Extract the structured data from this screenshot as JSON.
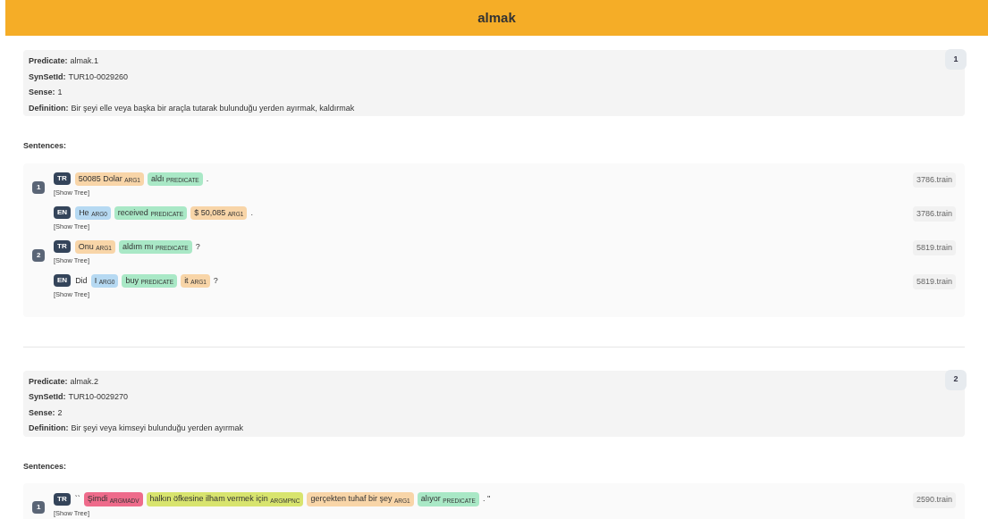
{
  "header": {
    "title": "almak"
  },
  "senses": [
    {
      "number": "1",
      "fields": [
        {
          "label": "Predicate:",
          "value": "almak.1"
        },
        {
          "label": "SynSetId:",
          "value": "TUR10-0029260"
        },
        {
          "label": "Sense:",
          "value": "1"
        },
        {
          "label": "Definition:",
          "value": "Bir şeyi elle veya başka bir araçla tutarak bulunduğu yerden ayırmak, kaldırmak"
        }
      ],
      "sentences_label": "Sentences:",
      "sentences": [
        {
          "index": "1",
          "lang": "TR",
          "tree_link": "[Show Tree]",
          "source": "3786.train",
          "tokens": [
            {
              "kind": "arg",
              "text": "50085 Dolar",
              "role": "ARG1",
              "color": "#f8d5a8"
            },
            {
              "kind": "arg",
              "text": "aldı",
              "role": "PREDICATE",
              "color": "#a9e8c6"
            },
            {
              "kind": "plain",
              "text": "."
            }
          ]
        },
        {
          "lang": "EN",
          "tree_link": "[Show Tree]",
          "source": "3786.train",
          "tokens": [
            {
              "kind": "arg",
              "text": "He",
              "role": "ARG0",
              "color": "#b6d9f2"
            },
            {
              "kind": "arg",
              "text": "received",
              "role": "PREDICATE",
              "color": "#a9e8c6"
            },
            {
              "kind": "arg",
              "text": "$ 50,085",
              "role": "ARG1",
              "color": "#f8d5a8"
            },
            {
              "kind": "plain",
              "text": "."
            }
          ]
        },
        {
          "index": "2",
          "lang": "TR",
          "tree_link": "[Show Tree]",
          "source": "5819.train",
          "tokens": [
            {
              "kind": "arg",
              "text": "Onu",
              "role": "ARG1",
              "color": "#f8d5a8"
            },
            {
              "kind": "arg",
              "text": "aldım mı",
              "role": "PREDICATE",
              "color": "#a9e8c6"
            },
            {
              "kind": "plain",
              "text": "?"
            }
          ]
        },
        {
          "lang": "EN",
          "tree_link": "[Show Tree]",
          "source": "5819.train",
          "tokens": [
            {
              "kind": "plain",
              "text": "Did"
            },
            {
              "kind": "arg",
              "text": "I",
              "role": "ARG0",
              "color": "#b6d9f2"
            },
            {
              "kind": "arg",
              "text": "buy",
              "role": "PREDICATE",
              "color": "#a9e8c6"
            },
            {
              "kind": "arg",
              "text": "it",
              "role": "ARG1",
              "color": "#f8d5a8"
            },
            {
              "kind": "plain",
              "text": "?"
            }
          ]
        }
      ]
    },
    {
      "number": "2",
      "fields": [
        {
          "label": "Predicate:",
          "value": "almak.2"
        },
        {
          "label": "SynSetId:",
          "value": "TUR10-0029270"
        },
        {
          "label": "Sense:",
          "value": "2"
        },
        {
          "label": "Definition:",
          "value": "Bir şeyi veya kimseyi bulunduğu yerden ayırmak"
        }
      ],
      "sentences_label": "Sentences:",
      "sentences": [
        {
          "index": "1",
          "lang": "TR",
          "tree_link": "[Show Tree]",
          "source": "2590.train",
          "tokens": [
            {
              "kind": "plain",
              "text": "``"
            },
            {
              "kind": "arg",
              "text": "Şimdi",
              "role": "ARGMADV",
              "color": "#ee6b8b"
            },
            {
              "kind": "arg",
              "text": "halkın öfkesine ilham vermek için",
              "role": "ARGMPNC",
              "color": "#d8e46e"
            },
            {
              "kind": "arg",
              "text": "gerçekten tuhaf bir şey",
              "role": "ARG1",
              "color": "#f8d5a8"
            },
            {
              "kind": "arg",
              "text": "alıyor",
              "role": "PREDICATE",
              "color": "#a9e8c6"
            },
            {
              "kind": "plain",
              "text": ". ''"
            }
          ]
        }
      ]
    }
  ]
}
